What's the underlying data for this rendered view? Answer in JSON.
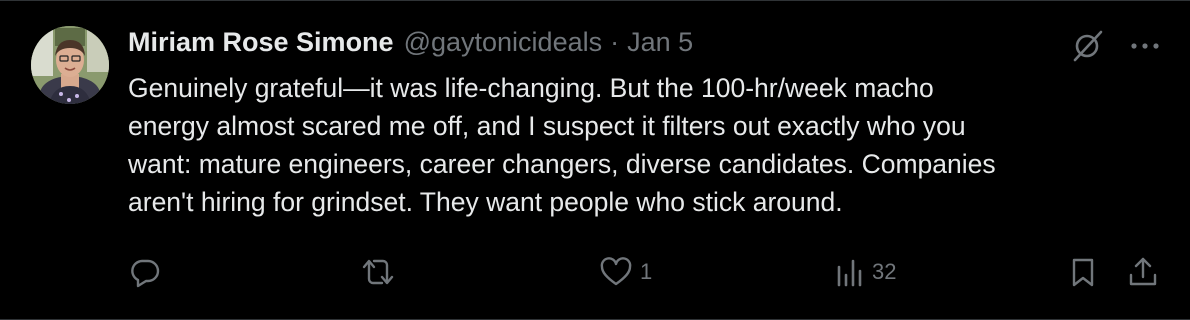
{
  "tweet": {
    "display_name": "Miriam Rose Simone",
    "handle": "@gaytonicideals",
    "separator": "·",
    "date": "Jan 5",
    "text": "Genuinely grateful—it was life-changing. But the 100-hr/week macho\nenergy almost scared me off, and I suspect it filters out exactly who you\nwant: mature engineers, career changers, diverse candidates. Companies\naren't hiring for grindset. They want people who stick around."
  },
  "top_actions": {
    "grok_icon": "grok-slash-icon",
    "more_icon": "more-horizontal-icon"
  },
  "actions": {
    "reply": {
      "icon": "reply-icon",
      "count": ""
    },
    "repost": {
      "icon": "repost-icon",
      "count": ""
    },
    "like": {
      "icon": "heart-icon",
      "count": "1"
    },
    "views": {
      "icon": "views-chart-icon",
      "count": "32"
    },
    "bookmark": {
      "icon": "bookmark-icon"
    },
    "share": {
      "icon": "share-icon"
    }
  },
  "colors": {
    "background": "#000000",
    "text_primary": "#e7e9ea",
    "text_secondary": "#71767b",
    "border": "#2f3336"
  }
}
